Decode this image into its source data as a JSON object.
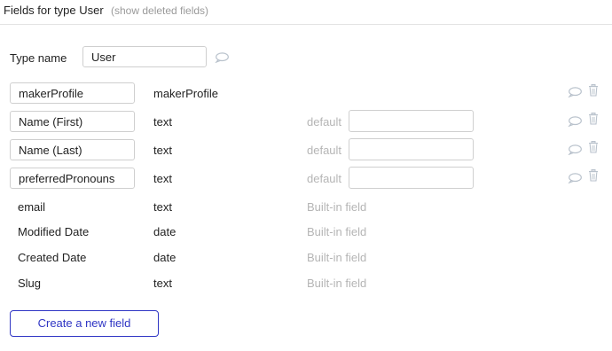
{
  "header": {
    "title": "Fields for type User",
    "show_deleted_label": "(show deleted fields)"
  },
  "type_name": {
    "label": "Type name",
    "value": "User"
  },
  "editable_fields": [
    {
      "name": "makerProfile",
      "type": "makerProfile",
      "has_default": false
    },
    {
      "name": "Name (First)",
      "type": "text",
      "has_default": true,
      "default_label": "default",
      "default_value": ""
    },
    {
      "name": "Name (Last)",
      "type": "text",
      "has_default": true,
      "default_label": "default",
      "default_value": ""
    },
    {
      "name": "preferredPronouns",
      "type": "text",
      "has_default": true,
      "default_label": "default",
      "default_value": ""
    }
  ],
  "builtin_fields": [
    {
      "name": "email",
      "type": "text",
      "note": "Built-in field"
    },
    {
      "name": "Modified Date",
      "type": "date",
      "note": "Built-in field"
    },
    {
      "name": "Created Date",
      "type": "date",
      "note": "Built-in field"
    },
    {
      "name": "Slug",
      "type": "text",
      "note": "Built-in field"
    }
  ],
  "create_button_label": "Create a new field",
  "icons": {
    "comment": "speech-bubble-icon",
    "delete": "trash-icon"
  },
  "colors": {
    "accent": "#2f35c4",
    "muted_text": "#b5b5b5",
    "icon": "#b9c2cc"
  }
}
